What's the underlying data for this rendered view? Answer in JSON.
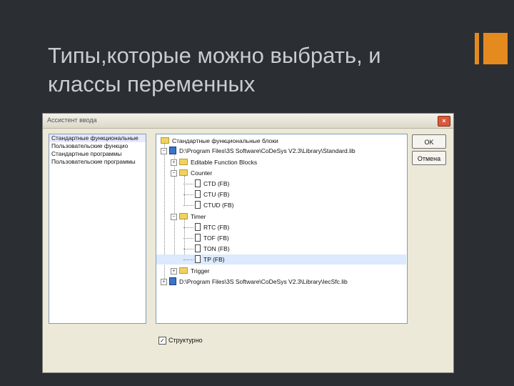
{
  "slide": {
    "title_line1": "Типы,которые можно выбрать, и",
    "title_line2": "классы переменных"
  },
  "dialog": {
    "title": "Ассистент ввода",
    "close_label": "×",
    "ok_label": "OK",
    "cancel_label": "Отмена",
    "categories": [
      "Стандартные функциональные",
      "Пользовательские функцио",
      "Стандартные программы",
      "Пользовательские программы"
    ],
    "tree": {
      "root_label": "Стандартные функциональные блоки",
      "lib1": "D:\\Program Files\\3S Software\\CoDeSys V2.3\\Library\\Standard.lib",
      "editable": "Editable Function Blocks",
      "counter": "Counter",
      "ctd": "CTD (FB)",
      "ctu": "CTU (FB)",
      "ctud": "CTUD (FB)",
      "timer": "Timer",
      "rtc": "RTC (FB)",
      "tof": "TOF (FB)",
      "ton": "TON (FB)",
      "tp": "TP (FB)",
      "trigger": "Trigger",
      "lib2": "D:\\Program Files\\3S Software\\CoDeSys V2.3\\Library\\IecSfc.lib"
    },
    "structured_label": "Структурно",
    "structured_checked": "✓"
  }
}
